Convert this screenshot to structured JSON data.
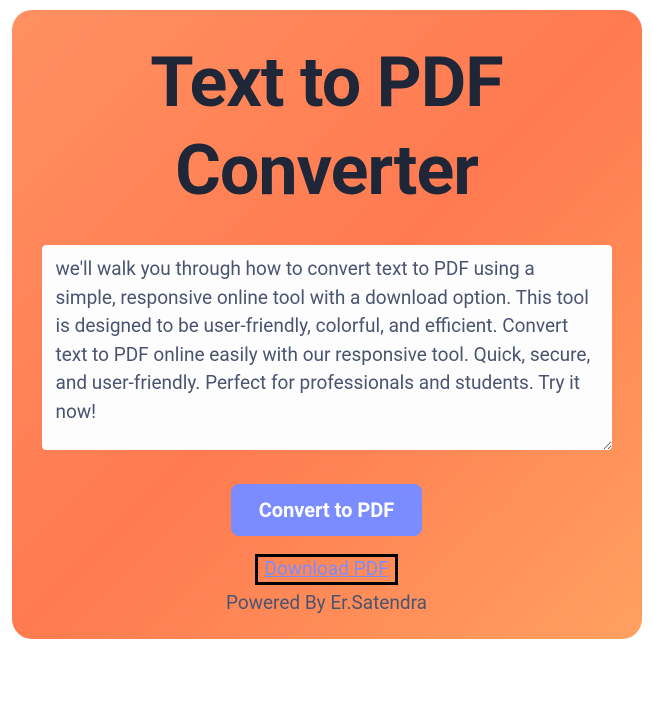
{
  "title": "Text to PDF Converter",
  "textarea": {
    "value": "we'll walk you through how to convert text to PDF using a simple, responsive online tool with a download option. This tool is designed to be user-friendly, colorful, and efficient. Convert text to PDF online easily with our responsive tool. Quick, secure, and user-friendly. Perfect for professionals and students. Try it now!"
  },
  "convert_button_label": "Convert to PDF",
  "download_link_label": "Download PDF",
  "powered_by": "Powered By Er.Satendra"
}
